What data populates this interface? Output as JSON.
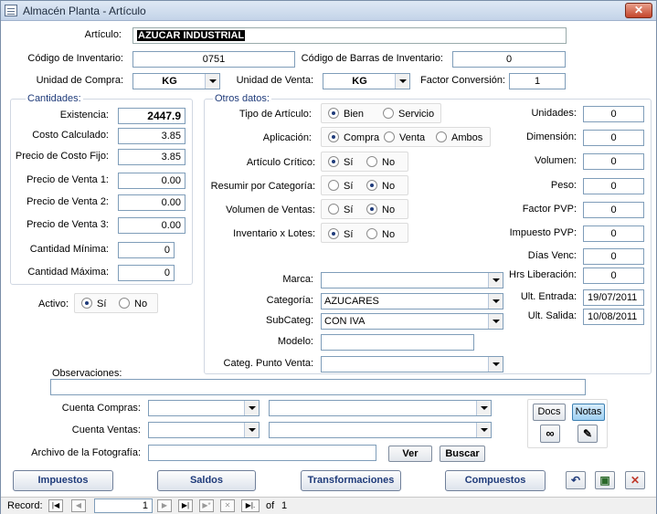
{
  "window": {
    "title": "Almacén Planta - Artículo",
    "close_label": "✕"
  },
  "articulo": {
    "label": "Artículo:",
    "value": "AZUCAR INDUSTRIAL"
  },
  "codigo_inventario": {
    "label": "Código de Inventario:",
    "value": "0751"
  },
  "codigo_barras": {
    "label": "Código de Barras de Inventario:",
    "value": "0"
  },
  "unidad_compra": {
    "label": "Unidad de Compra:",
    "value": "KG"
  },
  "unidad_venta": {
    "label": "Unidad de Venta:",
    "value": "KG"
  },
  "factor_conversion": {
    "label": "Factor Conversión:",
    "value": "1"
  },
  "cantidades": {
    "title": "Cantidades:",
    "fields": [
      {
        "label": "Existencia:",
        "value": "2447.9"
      },
      {
        "label": "Costo Calculado:",
        "value": "3.85"
      },
      {
        "label": "Precio de Costo Fijo:",
        "value": "3.85"
      },
      {
        "label": "Precio de Venta 1:",
        "value": "0.00"
      },
      {
        "label": "Precio de Venta 2:",
        "value": "0.00"
      },
      {
        "label": "Precio de Venta 3:",
        "value": "0.00"
      },
      {
        "label": "Cantidad Mínima:",
        "value": "0"
      },
      {
        "label": "Cantidad Máxima:",
        "value": "0"
      }
    ]
  },
  "activo": {
    "label": "Activo:",
    "si": "Sí",
    "no": "No"
  },
  "otros": {
    "title": "Otros datos:",
    "tipo": {
      "label": "Tipo de Artículo:",
      "opt1": "Bien",
      "opt2": "Servicio"
    },
    "aplicacion": {
      "label": "Aplicación:",
      "opt1": "Compra",
      "opt2": "Venta",
      "opt3": "Ambos"
    },
    "critico": {
      "label": "Artículo Crítico:",
      "opt1": "Sí",
      "opt2": "No"
    },
    "resumir": {
      "label": "Resumir por Categoría:",
      "opt1": "Sí",
      "opt2": "No"
    },
    "volumen_ventas": {
      "label": "Volumen de Ventas:",
      "opt1": "Sí",
      "opt2": "No"
    },
    "lotes": {
      "label": "Inventario x Lotes:",
      "opt1": "Sí",
      "opt2": "No"
    },
    "marca": {
      "label": "Marca:",
      "value": ""
    },
    "categoria": {
      "label": "Categoría:",
      "value": "AZUCARES"
    },
    "subcateg": {
      "label": "SubCateg:",
      "value": "CON IVA"
    },
    "modelo": {
      "label": "Modelo:",
      "value": ""
    },
    "categ_pv": {
      "label": "Categ. Punto Venta:",
      "value": ""
    },
    "right": [
      {
        "label": "Unidades:",
        "value": "0"
      },
      {
        "label": "Dimensión:",
        "value": "0"
      },
      {
        "label": "Volumen:",
        "value": "0"
      },
      {
        "label": "Peso:",
        "value": "0"
      },
      {
        "label": "Factor PVP:",
        "value": "0"
      },
      {
        "label": "Impuesto  PVP:",
        "value": "0"
      },
      {
        "label": "Días Venc:",
        "value": "0"
      },
      {
        "label": "Hrs Liberación:",
        "value": "0"
      },
      {
        "label": "Ult. Entrada:",
        "value": "19/07/2011"
      },
      {
        "label": "Ult. Salida:",
        "value": "10/08/2011"
      }
    ]
  },
  "observaciones": {
    "label": "Observaciones:",
    "value": ""
  },
  "cuenta_compras": {
    "label": "Cuenta Compras:"
  },
  "cuenta_ventas": {
    "label": "Cuenta Ventas:"
  },
  "fotografia": {
    "label": "Archivo de la Fotografía:",
    "ver": "Ver",
    "buscar": "Buscar"
  },
  "docs_label": "Docs",
  "notas_label": "Notas",
  "buttons": {
    "impuestos": "Impuestos",
    "saldos": "Saldos",
    "transformaciones": "Transformaciones",
    "compuestos": "Compuestos"
  },
  "record": {
    "label": "Record:",
    "current": "1",
    "of": "of",
    "total": "1"
  }
}
